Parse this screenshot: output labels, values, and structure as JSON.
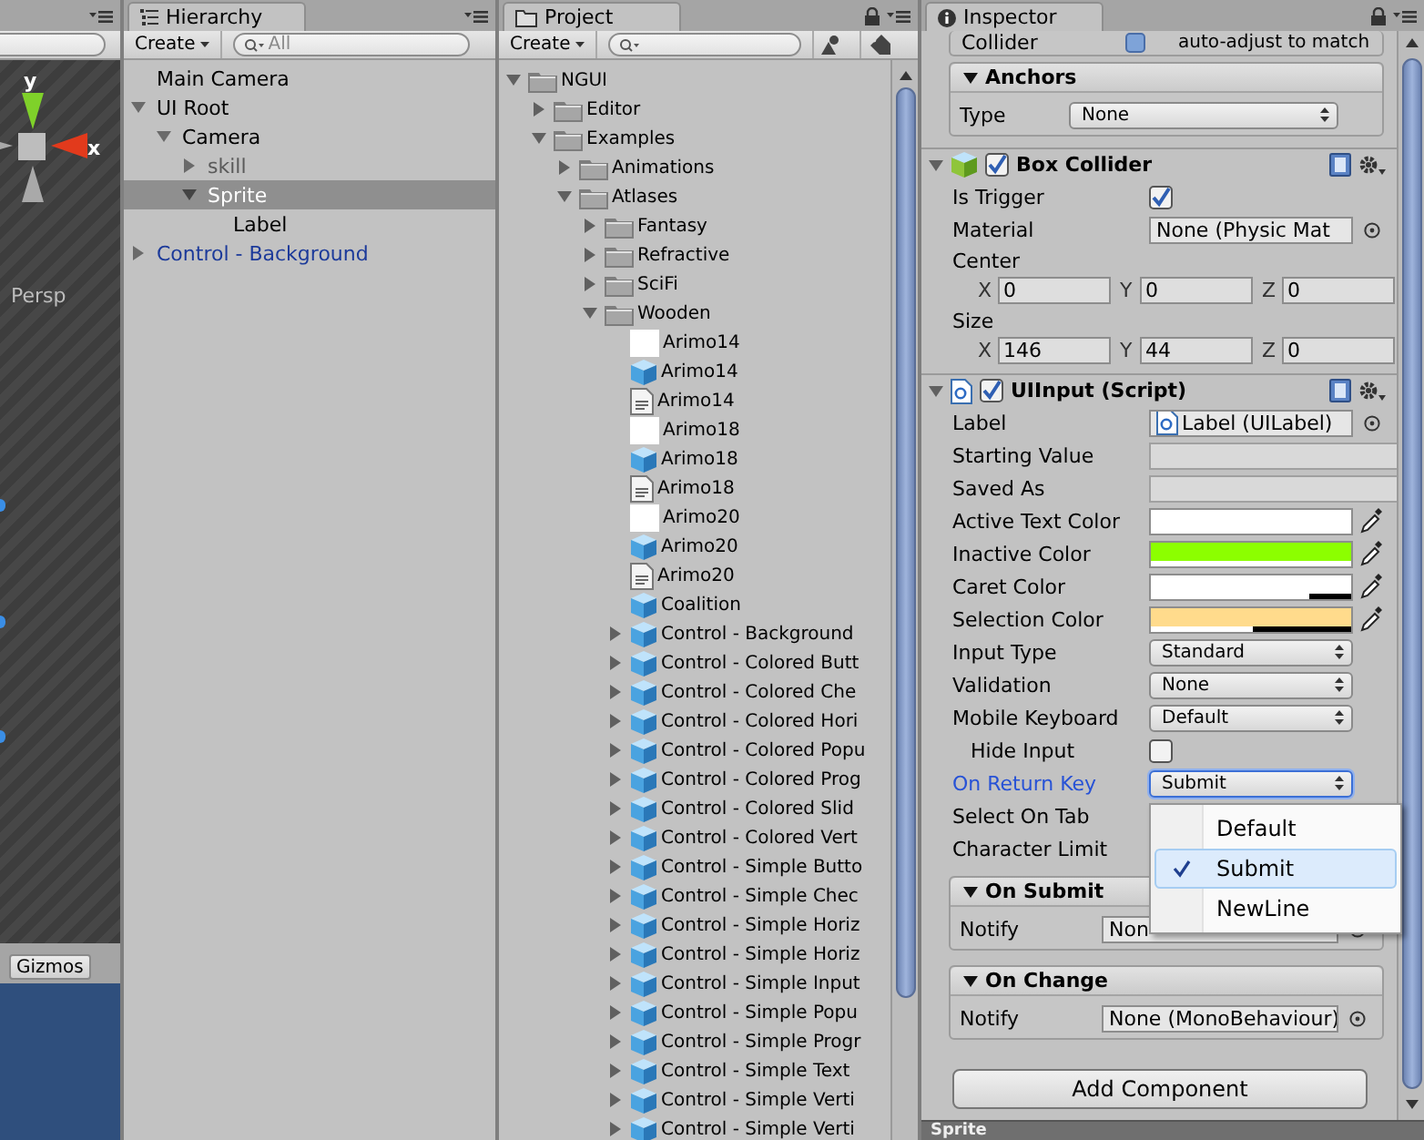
{
  "scene": {
    "axis_labels": [
      "y",
      "x"
    ],
    "view_mode": "Persp",
    "gizmos_button": "Gizmos"
  },
  "hierarchy": {
    "title": "Hierarchy",
    "create_button": "Create",
    "search": {
      "placeholder": "All"
    },
    "items": [
      {
        "label": "Main Camera",
        "kind": "object",
        "selected": false
      },
      {
        "label": "UI Root",
        "kind": "object",
        "expanded": true,
        "selected": false,
        "children": [
          {
            "label": "Camera",
            "kind": "object",
            "expanded": true,
            "selected": false,
            "children": [
              {
                "label": "skill",
                "kind": "inactive",
                "expanded": false,
                "selected": false
              },
              {
                "label": "Sprite",
                "kind": "object",
                "expanded": true,
                "selected": true,
                "children": [
                  {
                    "label": "Label",
                    "kind": "object",
                    "selected": false
                  }
                ]
              }
            ]
          }
        ]
      },
      {
        "label": "Control - Background",
        "kind": "prefab",
        "expanded": false,
        "selected": false
      }
    ]
  },
  "project": {
    "title": "Project",
    "create_button": "Create",
    "items": [
      {
        "label": "NGUI",
        "kind": "folder",
        "expanded": true,
        "children": [
          {
            "label": "Editor",
            "kind": "folder",
            "expanded": false
          },
          {
            "label": "Examples",
            "kind": "folder",
            "expanded": true,
            "children": [
              {
                "label": "Animations",
                "kind": "folder",
                "expanded": false
              },
              {
                "label": "Atlases",
                "kind": "folder",
                "expanded": true,
                "children": [
                  {
                    "label": "Fantasy",
                    "kind": "folder",
                    "expanded": false
                  },
                  {
                    "label": "Refractive",
                    "kind": "folder",
                    "expanded": false
                  },
                  {
                    "label": "SciFi",
                    "kind": "folder",
                    "expanded": false
                  },
                  {
                    "label": "Wooden",
                    "kind": "folder",
                    "expanded": true,
                    "children": [
                      {
                        "label": "Arimo14",
                        "kind": "texture"
                      },
                      {
                        "label": "Arimo14",
                        "kind": "prefab"
                      },
                      {
                        "label": "Arimo14",
                        "kind": "text"
                      },
                      {
                        "label": "Arimo18",
                        "kind": "texture"
                      },
                      {
                        "label": "Arimo18",
                        "kind": "prefab"
                      },
                      {
                        "label": "Arimo18",
                        "kind": "text"
                      },
                      {
                        "label": "Arimo20",
                        "kind": "texture"
                      },
                      {
                        "label": "Arimo20",
                        "kind": "prefab"
                      },
                      {
                        "label": "Arimo20",
                        "kind": "text"
                      },
                      {
                        "label": "Coalition",
                        "kind": "prefab"
                      },
                      {
                        "label": "Control - Background",
                        "kind": "prefab",
                        "expanded": false
                      },
                      {
                        "label": "Control - Colored Butt",
                        "kind": "prefab",
                        "expanded": false
                      },
                      {
                        "label": "Control - Colored Che",
                        "kind": "prefab",
                        "expanded": false
                      },
                      {
                        "label": "Control - Colored Hori",
                        "kind": "prefab",
                        "expanded": false
                      },
                      {
                        "label": "Control - Colored Popu",
                        "kind": "prefab",
                        "expanded": false
                      },
                      {
                        "label": "Control - Colored Prog",
                        "kind": "prefab",
                        "expanded": false
                      },
                      {
                        "label": "Control - Colored Slid",
                        "kind": "prefab",
                        "expanded": false
                      },
                      {
                        "label": "Control - Colored Vert",
                        "kind": "prefab",
                        "expanded": false
                      },
                      {
                        "label": "Control - Simple Butto",
                        "kind": "prefab",
                        "expanded": false
                      },
                      {
                        "label": "Control - Simple Chec",
                        "kind": "prefab",
                        "expanded": false
                      },
                      {
                        "label": "Control - Simple Horiz",
                        "kind": "prefab",
                        "expanded": false
                      },
                      {
                        "label": "Control - Simple Horiz",
                        "kind": "prefab",
                        "expanded": false
                      },
                      {
                        "label": "Control - Simple Input",
                        "kind": "prefab",
                        "expanded": false
                      },
                      {
                        "label": "Control - Simple Popu",
                        "kind": "prefab",
                        "expanded": false
                      },
                      {
                        "label": "Control - Simple Progr",
                        "kind": "prefab",
                        "expanded": false
                      },
                      {
                        "label": "Control - Simple Text",
                        "kind": "prefab",
                        "expanded": false
                      },
                      {
                        "label": "Control - Simple Verti",
                        "kind": "prefab",
                        "expanded": false
                      },
                      {
                        "label": "Control - Simple Verti",
                        "kind": "prefab",
                        "expanded": false
                      }
                    ]
                  }
                ]
              }
            ]
          }
        ]
      }
    ]
  },
  "inspector": {
    "title": "Inspector",
    "cut_row": {
      "label": "Collider",
      "value": "auto-adjust to match"
    },
    "anchors": {
      "title": "Anchors",
      "expanded": true,
      "fields": [
        {
          "kind": "dropdown",
          "label": "Type",
          "value": "None",
          "focused": false
        }
      ]
    },
    "components": [
      {
        "title": "Box Collider",
        "kind": "collider",
        "enabled": true,
        "expanded": true,
        "fields": [
          {
            "kind": "checkbox",
            "label": "Is Trigger",
            "checked": true,
            "indented": false
          },
          {
            "kind": "object",
            "label": "Material",
            "value": "None (Physic Mat"
          },
          {
            "kind": "heading",
            "label": "Center"
          },
          {
            "kind": "vector3",
            "axes": [
              {
                "axis": "X",
                "value": "0"
              },
              {
                "axis": "Y",
                "value": "0"
              },
              {
                "axis": "Z",
                "value": "0"
              }
            ]
          },
          {
            "kind": "heading",
            "label": "Size"
          },
          {
            "kind": "vector3",
            "axes": [
              {
                "axis": "X",
                "value": "146"
              },
              {
                "axis": "Y",
                "value": "44"
              },
              {
                "axis": "Z",
                "value": "0"
              }
            ]
          }
        ]
      },
      {
        "title": "UIInput (Script)",
        "kind": "script",
        "enabled": true,
        "expanded": true,
        "fields": [
          {
            "kind": "script_ref",
            "label": "Label",
            "value": "Label (UILabel)"
          },
          {
            "kind": "text",
            "label": "Starting Value"
          },
          {
            "kind": "text",
            "label": "Saved As"
          },
          {
            "kind": "color",
            "label": "Active Text Color",
            "color": "#ffffff",
            "level": 1
          },
          {
            "kind": "color",
            "label": "Inactive Color",
            "color": "#8cff00",
            "level": 1
          },
          {
            "kind": "color",
            "label": "Caret Color",
            "color": "#ffffff",
            "level": 0.79
          },
          {
            "kind": "color",
            "label": "Selection Color",
            "color": "#ffdb8c",
            "level": 0.51
          },
          {
            "kind": "dropdown",
            "label": "Input Type",
            "value": "Standard",
            "focused": false
          },
          {
            "kind": "dropdown",
            "label": "Validation",
            "value": "None",
            "focused": false
          },
          {
            "kind": "dropdown",
            "label": "Mobile Keyboard",
            "value": "Default",
            "focused": false
          },
          {
            "kind": "checkbox",
            "label": "Hide Input",
            "checked": false,
            "indented": true
          },
          {
            "kind": "dropdown",
            "label": "On Return Key",
            "value": "Submit",
            "focused": true
          },
          {
            "kind": "plain",
            "label": "Select On Tab"
          },
          {
            "kind": "plain",
            "label": "Character Limit"
          }
        ]
      }
    ],
    "events": [
      {
        "title": "On Submit",
        "expanded": true,
        "fields": [
          {
            "kind": "object",
            "label": "Notify",
            "value": "Non"
          }
        ]
      },
      {
        "title": "On Change",
        "expanded": true,
        "fields": [
          {
            "kind": "object",
            "label": "Notify",
            "value": "None (MonoBehaviour)"
          }
        ]
      }
    ],
    "add_button": "Add Component",
    "preview_title": "Sprite"
  },
  "popup": {
    "options": [
      {
        "label": "Default",
        "selected": false
      },
      {
        "label": "Submit",
        "selected": true
      },
      {
        "label": "NewLine",
        "selected": false
      }
    ]
  }
}
